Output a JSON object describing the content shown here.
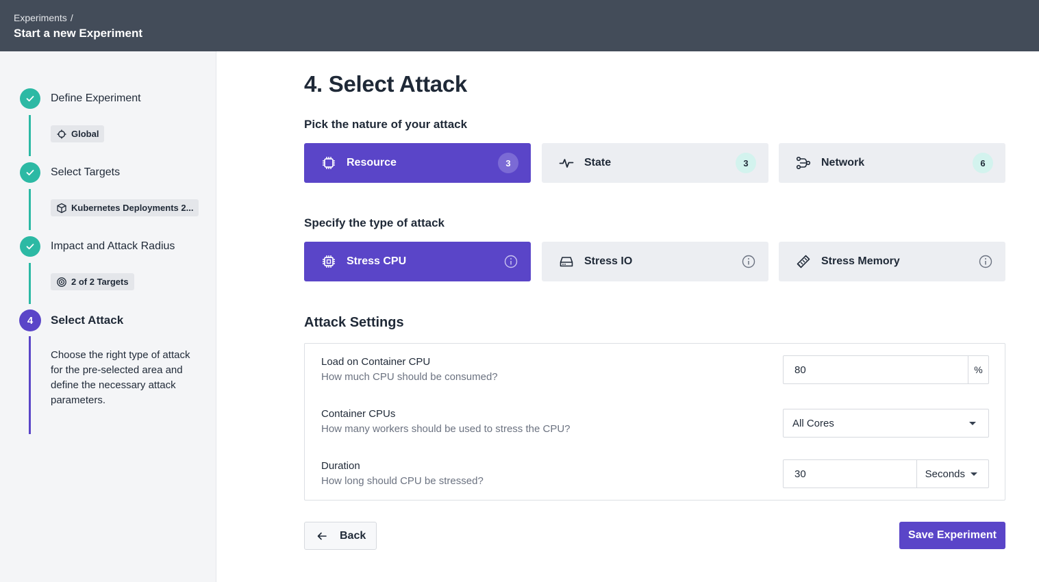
{
  "header": {
    "breadcrumb_parent": "Experiments",
    "breadcrumb_separator": "/",
    "title": "Start a new Experiment"
  },
  "sidebar": {
    "steps": [
      {
        "label": "Define Experiment",
        "status": "done",
        "chip": "Global",
        "chip_icon": "crosshair-icon"
      },
      {
        "label": "Select Targets",
        "status": "done",
        "chip": "Kubernetes Deployments 2...",
        "chip_icon": "kubernetes-icon"
      },
      {
        "label": "Impact and Attack Radius",
        "status": "done",
        "chip": "2 of 2 Targets",
        "chip_icon": "target-icon"
      },
      {
        "label": "Select Attack",
        "status": "active",
        "number": "4",
        "description": "Choose the right type of attack for the pre-selected area and define the necessary attack parameters."
      }
    ]
  },
  "main": {
    "title": "4. Select Attack",
    "nature_label": "Pick the nature of your attack",
    "natures": [
      {
        "label": "Resource",
        "count": "3",
        "icon": "cpu-chip-icon",
        "selected": true
      },
      {
        "label": "State",
        "count": "3",
        "icon": "pulse-icon",
        "selected": false
      },
      {
        "label": "Network",
        "count": "6",
        "icon": "network-icon",
        "selected": false
      }
    ],
    "type_label": "Specify the type of attack",
    "types": [
      {
        "label": "Stress CPU",
        "icon": "cpu-icon",
        "selected": true
      },
      {
        "label": "Stress IO",
        "icon": "hard-drive-icon",
        "selected": false
      },
      {
        "label": "Stress Memory",
        "icon": "memory-icon",
        "selected": false
      }
    ],
    "settings_heading": "Attack Settings",
    "settings": {
      "load": {
        "label": "Load on Container CPU",
        "help": "How much CPU should be consumed?",
        "value": "80",
        "unit": "%"
      },
      "cpus": {
        "label": "Container CPUs",
        "help": "How many workers should be used to stress the CPU?",
        "value": "All Cores"
      },
      "duration": {
        "label": "Duration",
        "help": "How long should CPU be stressed?",
        "value": "30",
        "unit": "Seconds"
      }
    },
    "back_label": "Back",
    "save_label": "Save Experiment"
  },
  "colors": {
    "header_bg": "#434c59",
    "accent": "#5a45c8",
    "done": "#2cb9a4",
    "card_bg": "#eceef2",
    "sidebar_bg": "#f4f5f7"
  }
}
